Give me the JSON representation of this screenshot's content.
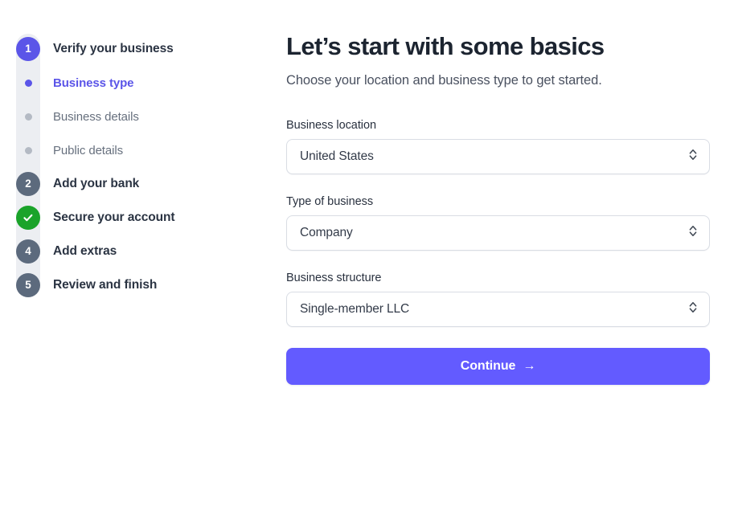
{
  "stepper": {
    "steps": [
      {
        "marker": "1",
        "marker_state": "active",
        "label": "Verify your business",
        "type": "step"
      },
      {
        "marker": "dot",
        "marker_state": "active",
        "label": "Business type",
        "type": "substep",
        "current": true
      },
      {
        "marker": "dot",
        "marker_state": "inactive",
        "label": "Business details",
        "type": "substep",
        "current": false
      },
      {
        "marker": "dot",
        "marker_state": "inactive",
        "label": "Public details",
        "type": "substep",
        "current": false
      },
      {
        "marker": "2",
        "marker_state": "pending",
        "label": "Add your bank",
        "type": "step"
      },
      {
        "marker": "check-icon",
        "marker_state": "done",
        "label": "Secure your account",
        "type": "step"
      },
      {
        "marker": "4",
        "marker_state": "pending",
        "label": "Add extras",
        "type": "step"
      },
      {
        "marker": "5",
        "marker_state": "pending",
        "label": "Review and finish",
        "type": "step"
      }
    ]
  },
  "main": {
    "title": "Let’s start with some basics",
    "subtitle": "Choose your location and business type to get started.",
    "fields": [
      {
        "label": "Business location",
        "value": "United States",
        "icon": "chevron-updown-icon"
      },
      {
        "label": "Type of business",
        "value": "Company",
        "icon": "chevron-updown-icon"
      },
      {
        "label": "Business structure",
        "value": "Single-member LLC",
        "icon": "chevron-updown-icon"
      }
    ],
    "continue_label": "Continue",
    "continue_arrow": "→"
  },
  "colors": {
    "accent_purple": "#635bff",
    "step_active": "#5b55e8",
    "step_pending": "#5c6a7d",
    "step_done_green": "#1aa32a",
    "track_gray": "#eceef2",
    "border_gray": "#d9dde4"
  }
}
